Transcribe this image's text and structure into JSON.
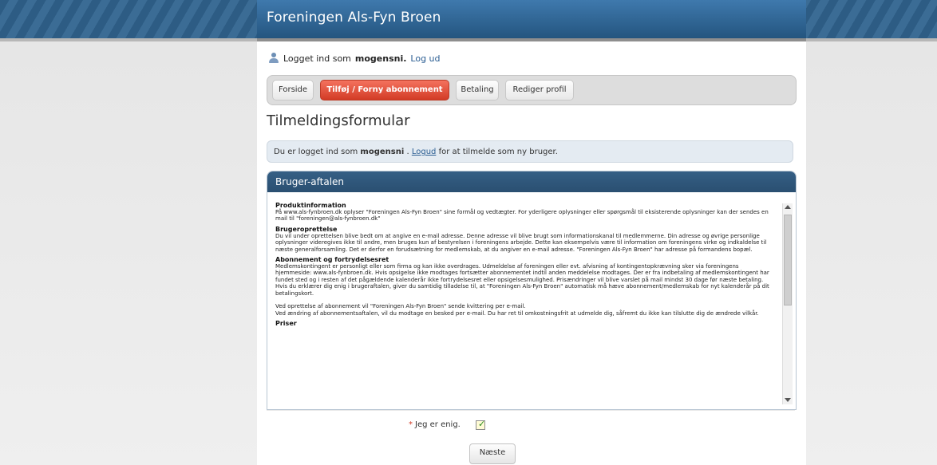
{
  "site": {
    "title": "Foreningen Als-Fyn Broen"
  },
  "login": {
    "prefix": "Logget ind som",
    "user": "mogensni.",
    "logout": "Log ud"
  },
  "tabs": [
    {
      "label": "Forside"
    },
    {
      "label": "Tilføj / Forny abonnement"
    },
    {
      "label": "Betaling"
    },
    {
      "label": "Rediger profil"
    }
  ],
  "form": {
    "title": "Tilmeldingsformular"
  },
  "info": {
    "prefix": "Du er logget ind som",
    "user": "mogensni",
    "sep": ".",
    "link": "Logud",
    "suffix": "for at tilmelde som ny bruger."
  },
  "panel": {
    "title": "Bruger-aftalen",
    "sections": [
      {
        "heading": "Produktinformation",
        "paragraphs": [
          "På www.als-fynbroen.dk oplyser \"Foreningen Als-Fyn Broen\" sine formål og vedtægter. For yderligere oplysninger eller spørgsmål til eksisterende oplysninger kan der sendes en mail til \"foreningen@als-fynbroen.dk\""
        ]
      },
      {
        "heading": "Brugeroprettelse",
        "paragraphs": [
          "Du vil under oprettelsen blive bedt om at angive en e-mail adresse. Denne adresse vil blive brugt som informationskanal til medlemmerne. Din adresse og øvrige personlige oplysninger videregives ikke til andre, men bruges kun af bestyrelsen i foreningens arbejde. Dette kan eksempelvis være til information om foreningens virke og indkaldelse til næste generalforsamling. Det er derfor en forudsætning for medlemskab, at du angiver en e-mail adresse. \"Foreningen Als-Fyn Broen\" har adresse på formandens bopæl."
        ]
      },
      {
        "heading": "Abonnement og fortrydelsesret",
        "paragraphs": [
          "Medlemskontingent er personligt eller som firma og kan ikke overdrages. Udmeldelse af foreningen eller evt. afvisning af kontingentopkrævning sker via foreningens hjemmeside: www.als-fynbroen.dk. Hvis opsigelse ikke modtages fortsætter abonnementet indtil anden meddelelse modtages. Der er fra indbetaling af medlemskontingent har fundet sted og i resten af det pågældende kalenderår ikke fortrydelsesret eller opsigelsesmulighed. Prisændringer vil blive varslet på mail mindst 30 dage før næste betaling.",
          "Hvis du erklærer dig enig i brugeraftalen, giver du samtidig tilladelse til, at \"Foreningen Als-Fyn Broen\" automatisk må hæve abonnement/medlemskab for nyt kalenderår på dit betalingskort.",
          "",
          "Ved oprettelse af abonnement vil \"Foreningen Als-Fyn Broen\" sende kvittering per e-mail.",
          "Ved ændring af abonnementsaftalen, vil du modtage en besked per e-mail. Du har ret til omkostningsfrit at udmelde dig, såfremt du ikke kan tilslutte dig de ændrede vilkår."
        ]
      },
      {
        "heading": "Priser",
        "paragraphs": []
      }
    ]
  },
  "agree": {
    "required_mark": "*",
    "label": "Jeg er enig.",
    "checked": true
  },
  "next": {
    "label": "Næste"
  },
  "colors": {
    "header": "#2d5c84",
    "active_tab": "#e0513b",
    "info_bg": "#e4ebf2"
  },
  "icons": {
    "user": "user-icon",
    "check": "checkmark-icon"
  }
}
